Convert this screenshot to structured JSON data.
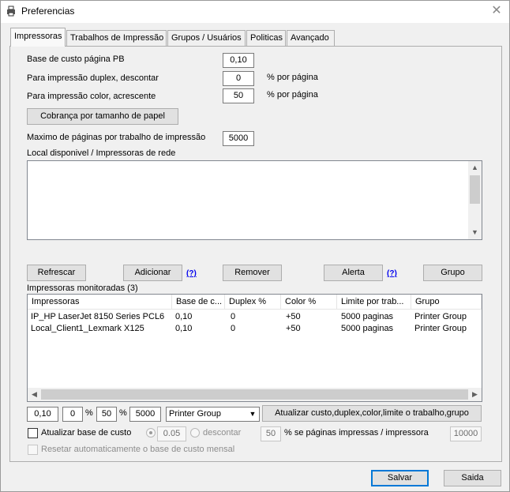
{
  "window": {
    "title": "Preferencias",
    "app_icon": "printer-app-icon",
    "close_icon": "close-icon"
  },
  "tabs": [
    {
      "label": "Impressoras",
      "active": true
    },
    {
      "label": "Trabalhos de Impressão",
      "active": false
    },
    {
      "label": "Grupos / Usuários",
      "active": false
    },
    {
      "label": "Politicas",
      "active": false
    },
    {
      "label": "Avançado",
      "active": false
    }
  ],
  "settings": {
    "base_cost_label": "Base de custo página PB",
    "base_cost_value": "0,10",
    "duplex_label": "Para impressão duplex, descontar",
    "duplex_value": "0",
    "duplex_unit": "% por página",
    "color_label": "Para impressão color, acrescente",
    "color_value": "50",
    "color_unit": "% por página",
    "paper_size_button": "Cobrança por tamanho de papel",
    "max_pages_label": "Maximo de páginas por trabalho de impressão",
    "max_pages_value": "5000",
    "local_printers_label": "Local disponivel / Impressoras de rede"
  },
  "actions": {
    "refresh": "Refrescar",
    "add": "Adicionar",
    "add_help": "(?)",
    "remove": "Remover",
    "alert": "Alerta",
    "alert_help": "(?)",
    "group": "Grupo"
  },
  "monitored": {
    "label": "Impressoras monitoradas (3)",
    "columns": [
      "Impressoras",
      "Base de c...",
      "Duplex %",
      "Color %",
      "Limite por trab...",
      "Grupo"
    ],
    "rows": [
      [
        "IP_HP LaserJet 8150 Series PCL6",
        "0,10",
        "0",
        "+50",
        "5000 paginas",
        "Printer Group"
      ],
      [
        "Local_Client1_Lexmark X125",
        "0,10",
        "0",
        "+50",
        "5000 paginas",
        "Printer Group"
      ]
    ]
  },
  "edit_row": {
    "cost": "0,10",
    "duplex": "0",
    "duplex_pct": "%",
    "color": "50",
    "color_pct": "%",
    "limit": "5000",
    "group": "Printer Group",
    "update_button": "Atualizar custo,duplex,color,limite o trabalho,grupo"
  },
  "auto_update": {
    "checkbox_label": "Atualizar base de custo",
    "checked": false,
    "rate_value": "0.05",
    "discount_label": "descontar",
    "pages_value": "50",
    "pages_label": "% se páginas impressas / impressora",
    "threshold_value": "10000",
    "reset_label": "Resetar automaticamente o base de custo mensal"
  },
  "footer": {
    "save": "Salvar",
    "exit": "Saida"
  }
}
